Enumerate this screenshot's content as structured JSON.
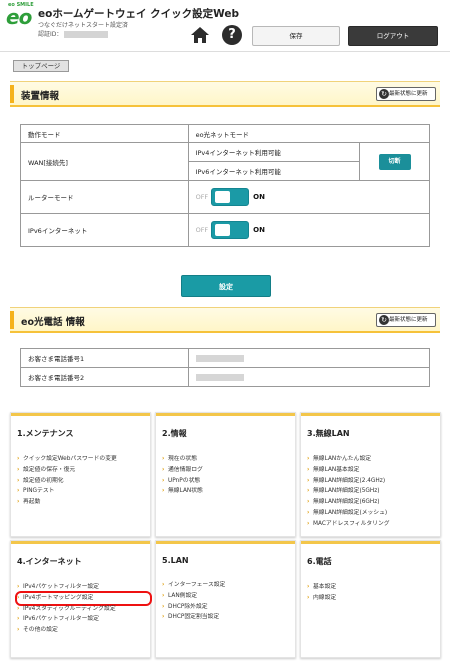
{
  "header": {
    "logo_text": "eo",
    "logo_tag": "eo SMILE",
    "title": "eoホームゲートウェイ クイック設定Web",
    "subtitle": "つなぐだけネットスタート設定済",
    "auth_label": "認証ID：",
    "save_label": "保存",
    "logout_label": "ログアウト"
  },
  "breadcrumb": {
    "top": "トップページ"
  },
  "device": {
    "title": "装置情報",
    "refresh": "最新状態に更新",
    "mode_label": "動作モード",
    "mode_value": "eo光ネットモード",
    "wan_label": "WAN[接続先]",
    "wan_ipv4": "IPv4インターネット利用可能",
    "wan_ipv6": "IPv6インターネット利用可能",
    "switch_label": "切断",
    "router_label": "ルーターモード",
    "ipv6_label": "IPv6インターネット",
    "toggle_off": "OFF",
    "toggle_on": "ON"
  },
  "set_button": "設定",
  "phone": {
    "title": "eo光電話 情報",
    "refresh": "最新状態に更新",
    "num1_label": "お客さま電話番号1",
    "num2_label": "お客さま電話番号2"
  },
  "menus": [
    {
      "title": "1.メンテナンス",
      "items": [
        "クイック設定Webパスワードの変更",
        "設定値の保存・復元",
        "設定値の初期化",
        "PINGテスト",
        "再起動"
      ]
    },
    {
      "title": "2.情報",
      "items": [
        "現在の状態",
        "通信情報ログ",
        "UPnPの状態",
        "無線LAN状態"
      ]
    },
    {
      "title": "3.無線LAN",
      "items": [
        "無線LANかんたん設定",
        "無線LAN基本設定",
        "無線LAN詳細設定(2.4GHz)",
        "無線LAN詳細設定(5GHz)",
        "無線LAN詳細設定(6GHz)",
        "無線LAN詳細設定(メッシュ)",
        "MACアドレスフィルタリング"
      ]
    },
    {
      "title": "4.インターネット",
      "items": [
        "IPv4パケットフィルター設定",
        "IPv4ポートマッピング設定",
        "IPv4スタティックルーティング設定",
        "IPv6パケットフィルター設定",
        "その他の設定"
      ]
    },
    {
      "title": "5.LAN",
      "items": [
        "インターフェース設定",
        "LAN側設定",
        "DHCP除外設定",
        "DHCP固定割当設定"
      ]
    },
    {
      "title": "6.電話",
      "items": [
        "基本設定",
        "内線設定"
      ]
    }
  ],
  "colors": {
    "accent": "#1a9ba5",
    "banner": "#f5b21b",
    "highlight": "#ee1111"
  }
}
